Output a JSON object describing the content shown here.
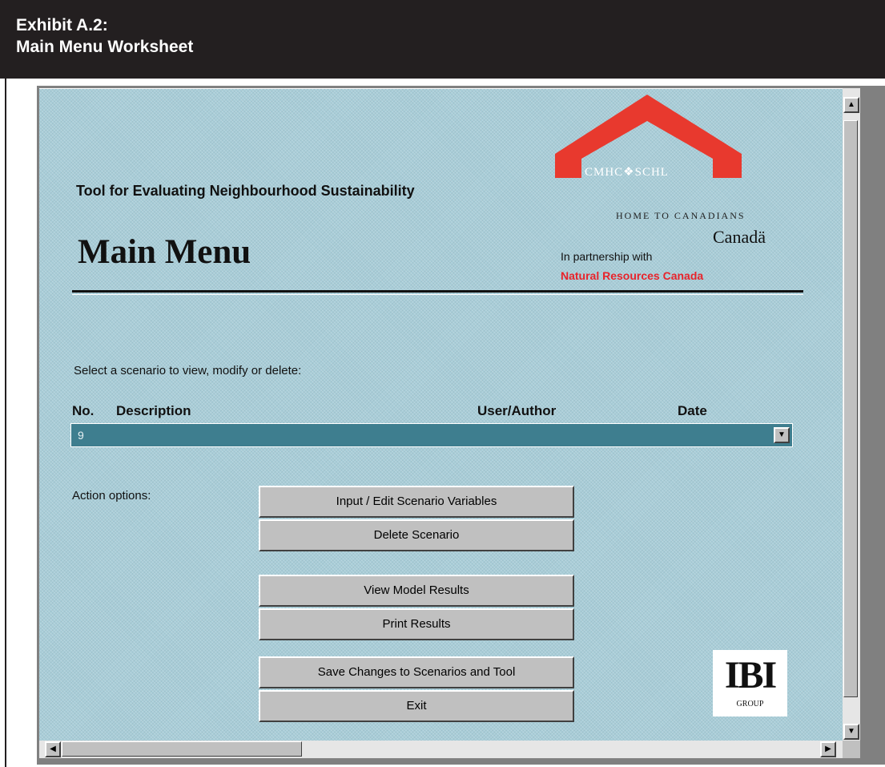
{
  "exhibit": {
    "line1": "Exhibit A.2:",
    "line2": "Main Menu Worksheet"
  },
  "app": {
    "tool_title": "Tool for Evaluating Neighbourhood Sustainability",
    "main_title": "Main Menu"
  },
  "logos": {
    "cmhc": "CMHC❖SCHL",
    "home": "HOME TO CANADIANS",
    "canada": "Canadä",
    "partnership": "In partnership with",
    "nrc": "Natural Resources Canada",
    "ibi_big": "IBI",
    "ibi_small": "GROUP",
    "cmhc_color": "#e8392e"
  },
  "scenario": {
    "prompt": "Select a scenario to view, modify or delete:",
    "columns": {
      "no": "No.",
      "description": "Description",
      "user": "User/Author",
      "date": "Date"
    },
    "selected_value": "9"
  },
  "actions": {
    "label": "Action options:",
    "input_edit": "Input / Edit Scenario Variables",
    "delete": "Delete Scenario",
    "view": "View Model Results",
    "print": "Print Results",
    "save": "Save Changes to Scenarios and Tool",
    "exit": "Exit"
  },
  "icons": {
    "scroll_up": "▲",
    "scroll_down": "▼",
    "scroll_left": "◀",
    "scroll_right": "▶",
    "dropdown": "▼"
  },
  "colors": {
    "sheet_bg": "#a8cdd8",
    "dropdown_bg": "#3e7e8f",
    "nrc_red": "#e8232b"
  }
}
